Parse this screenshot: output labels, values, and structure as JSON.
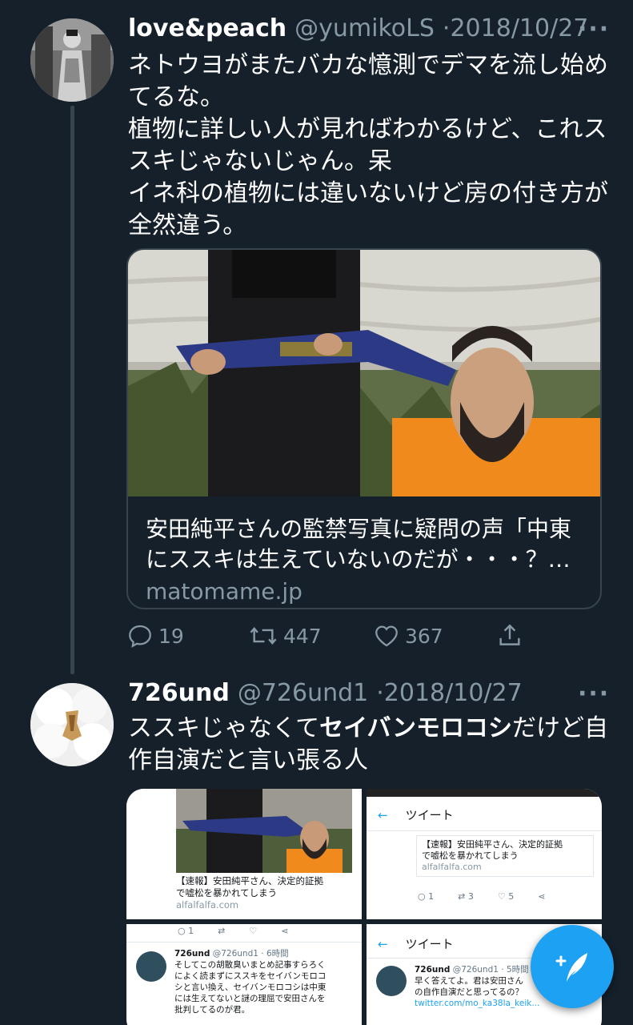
{
  "tweet1": {
    "display_name": "love&peach",
    "handle": "@yumikoLS",
    "separator": "·",
    "date": "2018/10/27",
    "more_icon": "ellipsis-icon",
    "text_lines": [
      "ネトウヨがまたバカな憶測でデマを流し始め",
      "てるな。",
      "植物に詳しい人が見ればわかるけど、これス",
      "スキじゃないじゃん。呆",
      "イネ科の植物には違いないけど房の付き方が",
      "全然違う。"
    ],
    "card": {
      "title_line1": "安田純平さんの監禁写真に疑問の声「中東",
      "title_line2": "にススキは生えていないのだが・・・？…",
      "domain": "matomame.jp"
    },
    "actions": {
      "replies": "19",
      "retweets": "447",
      "likes": "367"
    }
  },
  "tweet2": {
    "display_name": "726und",
    "handle": "@726und1",
    "separator": "·",
    "date": "2018/10/27",
    "text_line1_pre": "ススキじゃなくて",
    "text_line1_bold": "セイバンモロコシ",
    "text_line1_post": "だけど自",
    "text_line2": "作自演だと言い張る人",
    "media": {
      "tile1_title_line1": "【速報】安田純平さん、決定的証拠",
      "tile1_title_line2": "で嘘松を暴かれてしまう",
      "tile1_domain": "alfalfalfa.com",
      "tile2_header": "ツイート",
      "tile2_title_line1": "【速報】安田純平さん、決定的証拠",
      "tile2_title_line2": "で嘘松を暴かれてしまう",
      "tile2_domain": "alfalfalfa.com",
      "tile2_stat1": "1",
      "tile2_stat2": "3",
      "tile2_stat3": "5",
      "tile3_stat1": "1",
      "tile3_name": "726und",
      "tile3_handle_time": "@726und1 · 6時間",
      "tile3_lines": [
        "そしてこの胡散臭いまとめ記事すらろく",
        "によく読まずにススキをセイバンモロコ",
        "シと言い換え、セイバンモロコシは中東",
        "には生えてないと謎の理屈で安田さんを",
        "批判してるのが君。"
      ],
      "tile4_header": "ツイート",
      "tile4_name": "726und",
      "tile4_handle_time": "@726und1 · 5時間",
      "tile4_lines": [
        "早く答えてよ。君は安田さん",
        "の自作自演だと思ってるの？"
      ],
      "tile4_link": "twitter.com/mo_ka38la_keik..."
    }
  },
  "compose_button_icon": "compose-feather-icon",
  "colors": {
    "background": "#15202b",
    "text_primary": "#ffffff",
    "text_secondary": "#8899a6",
    "accent": "#1da1f2",
    "border": "#38444d"
  }
}
